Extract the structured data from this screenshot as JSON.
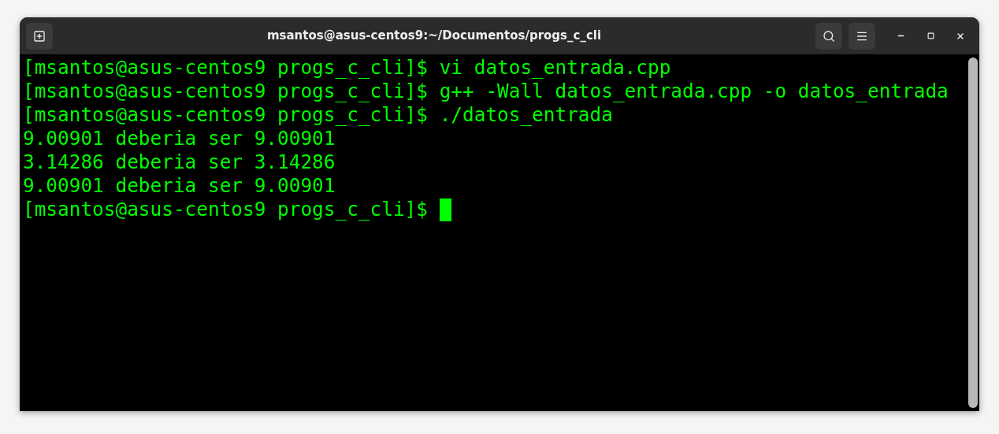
{
  "window": {
    "title": "msantos@asus-centos9:~/Documentos/progs_c_cli"
  },
  "terminal": {
    "lines": [
      {
        "text": "[msantos@asus-centos9 progs_c_cli]$ vi datos_entrada.cpp"
      },
      {
        "text": "[msantos@asus-centos9 progs_c_cli]$ g++ -Wall datos_entrada.cpp -o datos_entrada"
      },
      {
        "text": "[msantos@asus-centos9 progs_c_cli]$ ./datos_entrada"
      },
      {
        "text": "9.00901 deberia ser 9.00901"
      },
      {
        "text": "3.14286 deberia ser 3.14286"
      },
      {
        "text": "9.00901 deberia ser 9.00901"
      },
      {
        "text": "[msantos@asus-centos9 progs_c_cli]$ ",
        "cursor": true
      }
    ]
  }
}
